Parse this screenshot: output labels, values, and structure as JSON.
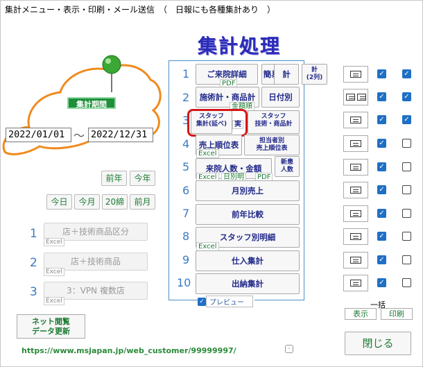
{
  "window": {
    "title": "集計メニュー・表示・印刷・メール送信　（　日報にも各種集計あり　）"
  },
  "header": {
    "title": "集計処理"
  },
  "period": {
    "label": "集計期間",
    "from": "2022/01/01",
    "separator": "～",
    "to": "2022/12/31"
  },
  "quick_dates": {
    "prev_year": "前年",
    "this_year": "今年",
    "today": "今日",
    "this_month": "今月",
    "close_20": "20締",
    "prev_month": "前月"
  },
  "left_menu": [
    {
      "num": "1",
      "label": "店＋技術商品区分",
      "tag": "Excel"
    },
    {
      "num": "2",
      "label": "店＋技術商品",
      "tag": "Excel"
    },
    {
      "num": "3",
      "label": "3：VPN 複数店",
      "tag": "Excel"
    }
  ],
  "net_button": {
    "line1": "ネット閲覧",
    "line2": "データ更新"
  },
  "url": "https://www.msjapan.jp/web_customer/99999997/",
  "rows": [
    {
      "num": "1"
    },
    {
      "num": "2"
    },
    {
      "num": "3"
    },
    {
      "num": "4"
    },
    {
      "num": "5"
    },
    {
      "num": "6"
    },
    {
      "num": "7"
    },
    {
      "num": "8"
    },
    {
      "num": "9"
    },
    {
      "num": "10"
    }
  ],
  "menu": {
    "r1": {
      "detail": "ご来院詳細",
      "detail_tag": "PDF",
      "simple": "簡易版",
      "kei": "計",
      "kei2_a": "計",
      "kei2_b": "(2列)"
    },
    "r2": {
      "treat": "施術計・商品計",
      "treat_tag": "金額順",
      "daily": "日付別"
    },
    "r3": {
      "staff_a1": "スタッフ",
      "staff_a2": "集計(延べ)",
      "staff_real": "実",
      "staff_b1": "スタッフ",
      "staff_b2": "技術・商品計"
    },
    "r4": {
      "sales": "売上順位表",
      "sales_tag": "Excel",
      "charge1": "担当者別",
      "charge2": "売上順位表"
    },
    "r5": {
      "visit": "来院人数・金額",
      "visit_tag1": "Excel",
      "visit_tag2": "日別明",
      "visit_tag3": "PDF",
      "new1": "新患",
      "new2": "人数"
    },
    "r6": "月別売上",
    "r7": "前年比較",
    "r8": {
      "label": "スタッフ別明細",
      "tag": "Excel"
    },
    "r9": "仕入集計",
    "r10": "出納集計"
  },
  "preview": {
    "label": "プレビュー",
    "checked": true
  },
  "right_checks": [
    {
      "icon": "single",
      "c1": true,
      "c2": true
    },
    {
      "icon": "double",
      "c1": true,
      "c2": true
    },
    {
      "icon": "single",
      "c1": true,
      "c2": true
    },
    {
      "icon": "single",
      "c1": true,
      "c2": false
    },
    {
      "icon": "single",
      "c1": true,
      "c2": false
    },
    {
      "icon": "single",
      "c1": true,
      "c2": false
    },
    {
      "icon": "single",
      "c1": true,
      "c2": false
    },
    {
      "icon": "single",
      "c1": true,
      "c2": false
    },
    {
      "icon": "single",
      "c1": true,
      "c2": false
    },
    {
      "icon": "single",
      "c1": true,
      "c2": false
    }
  ],
  "bulk": {
    "label": "一括",
    "show": "表示",
    "print": "印刷"
  },
  "close": "閉じる",
  "colors": {
    "accent_blue": "#2b2bb8",
    "green_text": "#1d7a33",
    "highlight_red": "#d41818",
    "cloud_orange": "#f08a1c"
  }
}
